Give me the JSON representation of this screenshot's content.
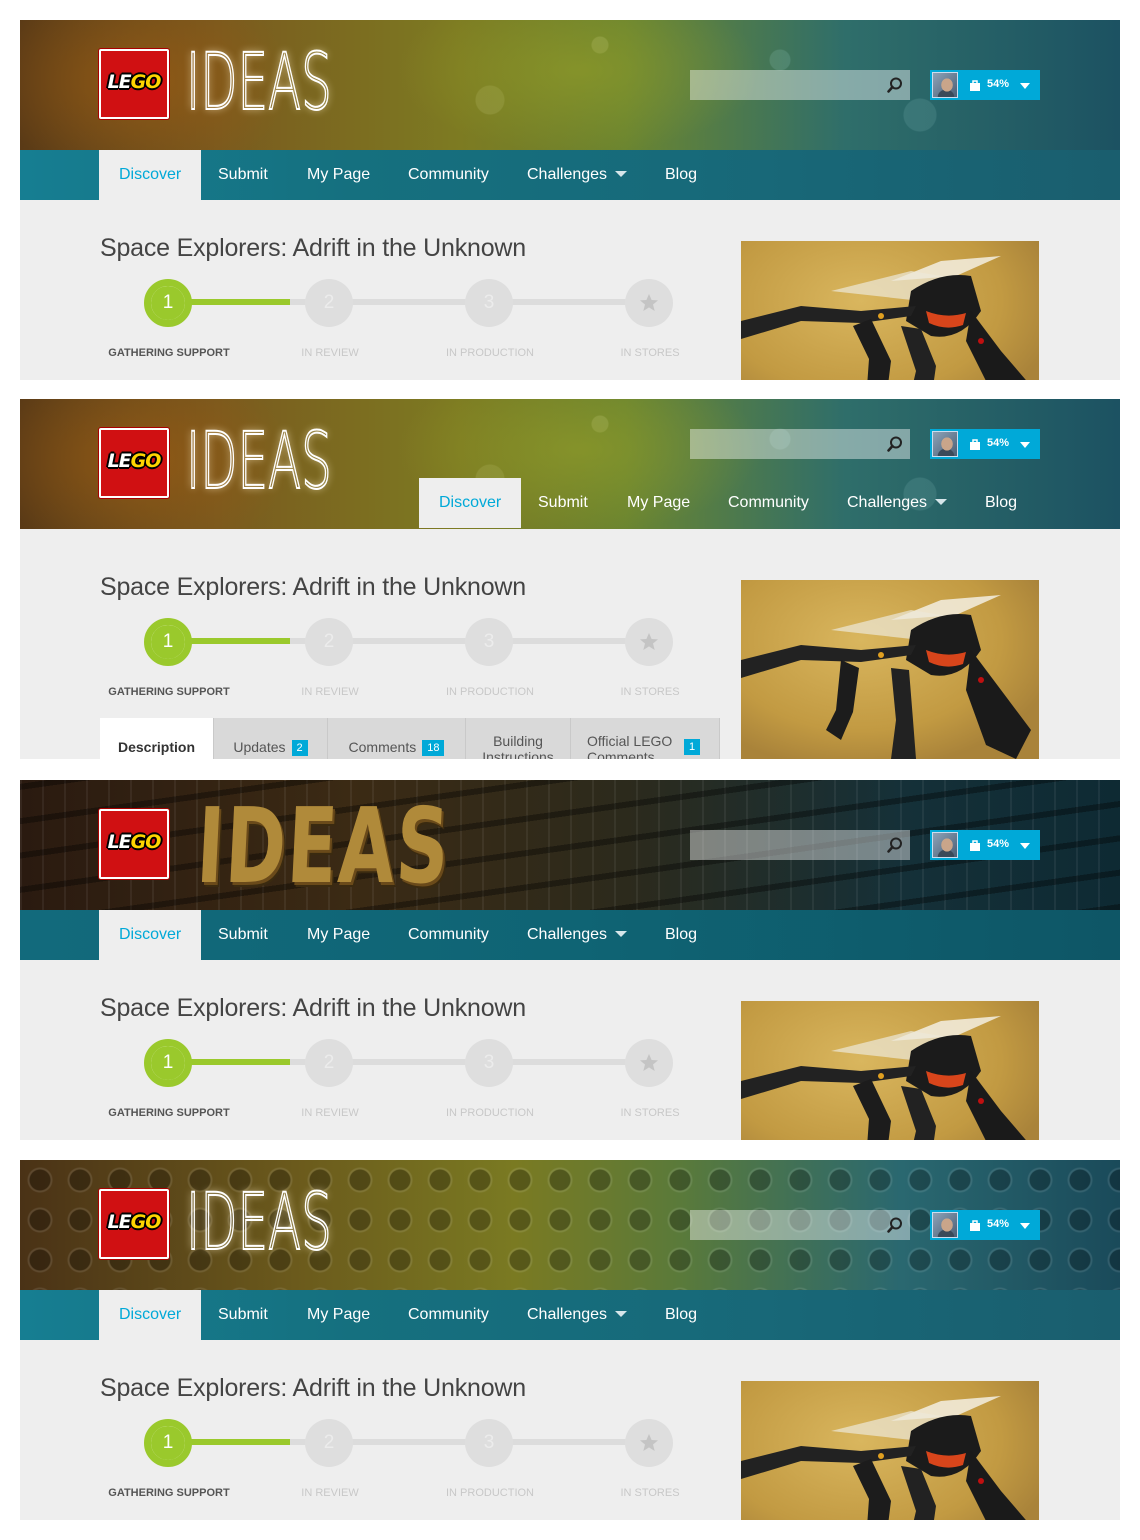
{
  "brand": {
    "logo_text_1": "LE",
    "logo_text_2": "GO",
    "product": "IDEAS"
  },
  "search": {
    "placeholder": "",
    "value": ""
  },
  "user": {
    "progress_label": "54%",
    "progress": 0.54
  },
  "nav": {
    "discover": "Discover",
    "submit": "Submit",
    "my_page": "My Page",
    "community": "Community",
    "challenges": "Challenges",
    "blog": "Blog"
  },
  "project": {
    "title": "Space Explorers: Adrift in the Unknown",
    "steps": [
      {
        "number": "1",
        "label": "GATHERING SUPPORT"
      },
      {
        "number": "2",
        "label": "IN REVIEW"
      },
      {
        "number": "3",
        "label": "IN PRODUCTION"
      },
      {
        "number": "",
        "label": "IN STORES"
      }
    ]
  },
  "tabs": {
    "description": "Description",
    "updates": "Updates",
    "updates_count": "2",
    "comments": "Comments",
    "comments_count": "18",
    "building": "Building Instructions",
    "official": "Official LEGO Comments",
    "official_count": "1"
  },
  "colors": {
    "accent": "#00a9d8",
    "progress_green": "#9ac92c",
    "nav_teal": "#167e92",
    "lego_red": "#d01012"
  },
  "icons": [
    "search-icon",
    "shopping-bag-icon",
    "chevron-down-icon",
    "star-icon"
  ]
}
